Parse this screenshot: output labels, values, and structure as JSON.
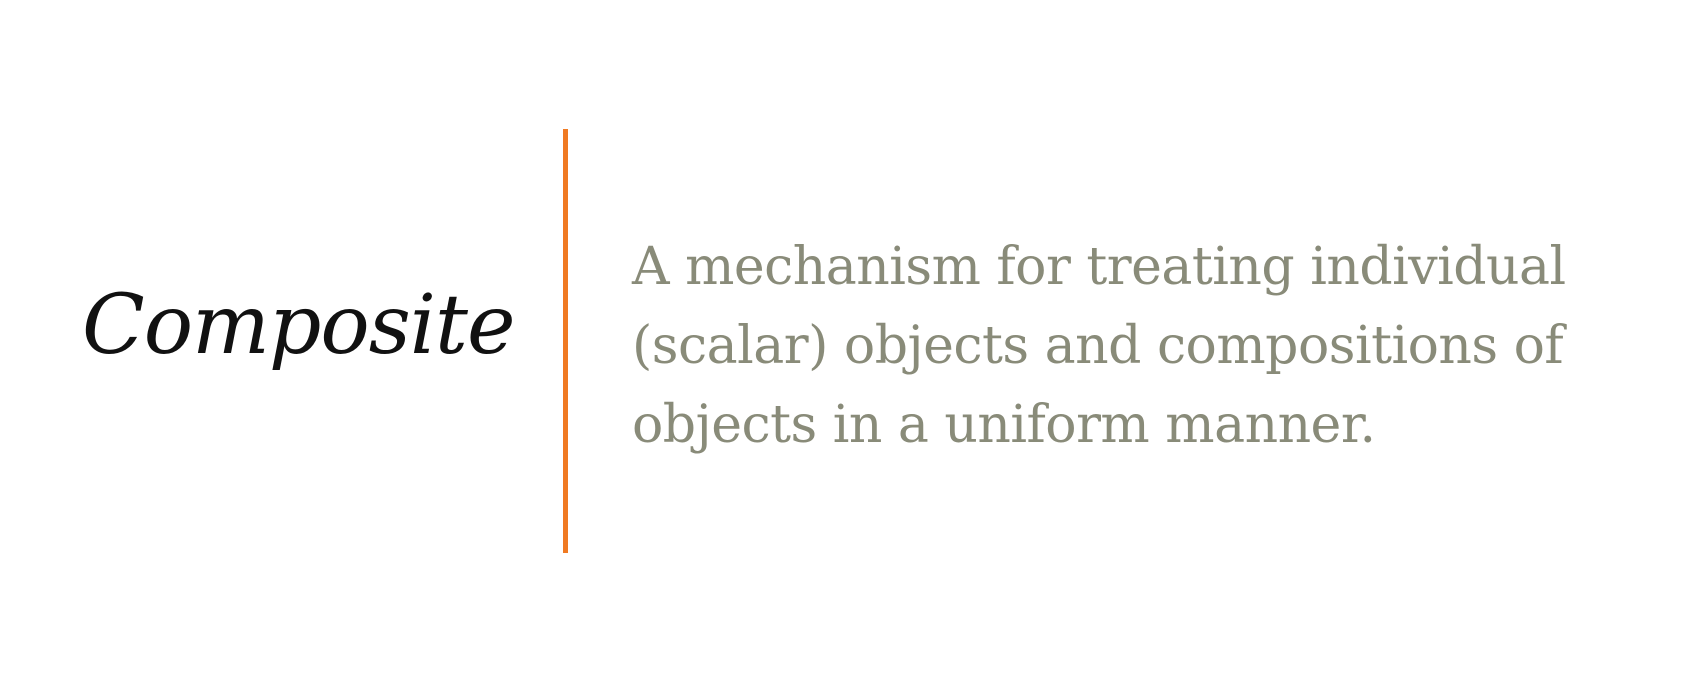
{
  "slide": {
    "term": "Composite",
    "definition_lines": [
      "A mechanism for treating individual",
      "(scalar) objects and compositions of",
      "objects in a uniform manner."
    ],
    "colors": {
      "background": "#ffffff",
      "term": "#111111",
      "divider": "#f07a22",
      "definition": "#898b79"
    }
  }
}
